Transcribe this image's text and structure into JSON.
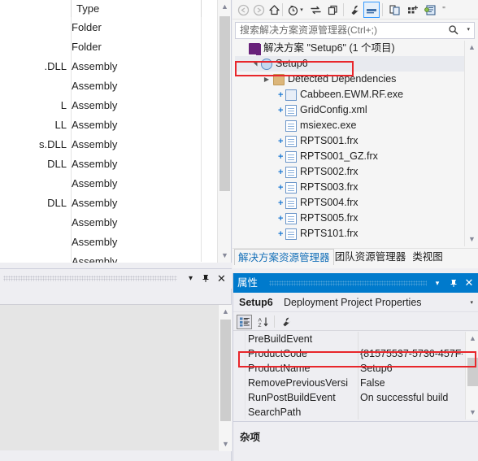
{
  "file_list": {
    "columns": [
      "",
      "Type"
    ],
    "rows": [
      {
        "name": "",
        "type": "Folder"
      },
      {
        "name": "",
        "type": "Folder"
      },
      {
        "name": ".DLL",
        "type": "Assembly"
      },
      {
        "name": "",
        "type": "Assembly"
      },
      {
        "name": "L",
        "type": "Assembly"
      },
      {
        "name": "LL",
        "type": "Assembly"
      },
      {
        "name": "s.DLL",
        "type": "Assembly"
      },
      {
        "name": "DLL",
        "type": "Assembly"
      },
      {
        "name": "",
        "type": "Assembly"
      },
      {
        "name": "DLL",
        "type": "Assembly"
      },
      {
        "name": "",
        "type": "Assembly"
      },
      {
        "name": "",
        "type": "Assembly"
      },
      {
        "name": "",
        "type": "Assembly"
      },
      {
        "name": "",
        "type": "Assembly"
      }
    ]
  },
  "left_bottom_panel": {
    "title": "",
    "dropdown_label": "▾",
    "pin_label": "⇲",
    "close_label": "✕"
  },
  "solution_explorer": {
    "toolbar": [
      {
        "name": "back-icon",
        "glyph": "⬅",
        "enabled": false
      },
      {
        "name": "forward-icon",
        "glyph": "➡",
        "enabled": false
      },
      {
        "name": "home-icon",
        "glyph": "⌂",
        "enabled": true
      },
      {
        "name": "pending-changes-icon",
        "glyph": "◷",
        "enabled": true
      },
      {
        "name": "pending-changes-dropdown-icon",
        "glyph": "▾",
        "enabled": true
      },
      {
        "name": "sync-with-active-document-icon",
        "glyph": "⇄",
        "enabled": true
      },
      {
        "name": "refresh-icon",
        "glyph": "❐",
        "enabled": true
      },
      {
        "name": "properties-icon",
        "glyph": "🔧",
        "enabled": true
      },
      {
        "name": "show-all-files-icon",
        "glyph": "▬",
        "enabled": true,
        "selected": true
      },
      {
        "name": "preview-selected-items-icon",
        "glyph": "🗏",
        "enabled": true
      },
      {
        "name": "new-folder-icon",
        "glyph": "⁘",
        "enabled": true
      },
      {
        "name": "view-designer-icon",
        "glyph": "🗔",
        "enabled": true
      },
      {
        "name": "overflow-chevron-icon",
        "glyph": "\"",
        "enabled": true
      }
    ],
    "search": {
      "placeholder": "搜索解决方案资源管理器(Ctrl+;)",
      "value": "",
      "search_icon": "search-icon",
      "dropdown_icon": "chevron-down-icon"
    },
    "tree": [
      {
        "label": "解决方案 \"Setup6\" (1 个项目)",
        "icon": "solution-icon",
        "depth": 0,
        "expander": "",
        "plus": false,
        "selected": false
      },
      {
        "label": "Setup6",
        "icon": "setup-project-icon",
        "depth": 1,
        "expander": "▲",
        "plus": false,
        "selected": true
      },
      {
        "label": "Detected Dependencies",
        "icon": "folder-icon",
        "depth": 2,
        "expander": "▶",
        "plus": false,
        "selected": false
      },
      {
        "label": "Cabbeen.EWM.RF.exe",
        "icon": "exe-icon",
        "depth": 3,
        "expander": "",
        "plus": true,
        "selected": false
      },
      {
        "label": "GridConfig.xml",
        "icon": "document-icon",
        "depth": 3,
        "expander": "",
        "plus": true,
        "selected": false
      },
      {
        "label": "msiexec.exe",
        "icon": "document-icon",
        "depth": 3,
        "expander": "",
        "plus": false,
        "selected": false
      },
      {
        "label": "RPTS001.frx",
        "icon": "document-icon",
        "depth": 3,
        "expander": "",
        "plus": true,
        "selected": false
      },
      {
        "label": "RPTS001_GZ.frx",
        "icon": "document-icon",
        "depth": 3,
        "expander": "",
        "plus": true,
        "selected": false
      },
      {
        "label": "RPTS002.frx",
        "icon": "document-icon",
        "depth": 3,
        "expander": "",
        "plus": true,
        "selected": false
      },
      {
        "label": "RPTS003.frx",
        "icon": "document-icon",
        "depth": 3,
        "expander": "",
        "plus": true,
        "selected": false
      },
      {
        "label": "RPTS004.frx",
        "icon": "document-icon",
        "depth": 3,
        "expander": "",
        "plus": true,
        "selected": false
      },
      {
        "label": "RPTS005.frx",
        "icon": "document-icon",
        "depth": 3,
        "expander": "",
        "plus": true,
        "selected": false
      },
      {
        "label": "RPTS101.frx",
        "icon": "document-icon",
        "depth": 3,
        "expander": "",
        "plus": true,
        "selected": false
      }
    ],
    "tabs": [
      {
        "label": "解决方案资源管理器",
        "active": true
      },
      {
        "label": "团队资源管理器",
        "active": false
      },
      {
        "label": "类视图",
        "active": false
      }
    ]
  },
  "properties": {
    "title": "属性",
    "dropdown_label": "▾",
    "pin_label": "⇲",
    "close_label": "✕",
    "object_name": "Setup6",
    "object_type": "Deployment Project Properties",
    "object_dropdown_icon": "chevron-down-icon",
    "toolbar": [
      {
        "name": "categorized-icon",
        "glyph": "▦",
        "selected": true
      },
      {
        "name": "alphabetical-sort-icon",
        "glyph": "A↓",
        "selected": false
      },
      {
        "name": "property-pages-icon",
        "glyph": "🔧",
        "selected": false
      }
    ],
    "rows": [
      {
        "key": "PreBuildEvent",
        "value": ""
      },
      {
        "key": "ProductCode",
        "value": "{81575537-5736-457F-"
      },
      {
        "key": "ProductName",
        "value": "Setup6"
      },
      {
        "key": "RemovePreviousVersi",
        "value": "False"
      },
      {
        "key": "RunPostBuildEvent",
        "value": "On successful build"
      },
      {
        "key": "SearchPath",
        "value": ""
      }
    ],
    "description_title": "杂项"
  },
  "annotations": {
    "highlight_color": "#e8262b",
    "boxes": [
      {
        "name": "setup6-node-highlight"
      },
      {
        "name": "productcode-row-highlight"
      }
    ]
  }
}
